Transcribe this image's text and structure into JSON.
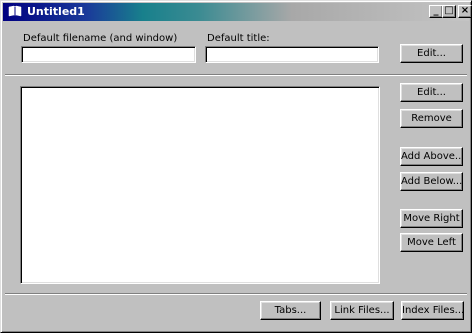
{
  "window": {
    "title": "Untitled1",
    "controls": {
      "minimize": "_",
      "maximize": "□",
      "close": "×"
    }
  },
  "form": {
    "default_filename_label": "Default filename (and window)",
    "default_filename_value": "",
    "default_title_label": "Default title:",
    "default_title_value": "",
    "edit_top_label": "Edit..."
  },
  "list": {
    "items": []
  },
  "side_buttons": {
    "edit": "Edit...",
    "remove": "Remove",
    "add_above": "Add Above...",
    "add_below": "Add Below...",
    "move_right": "Move Right",
    "move_left": "Move Left"
  },
  "bottom_buttons": {
    "tabs": "Tabs...",
    "link_files": "Link Files...",
    "index_files": "Index Files..."
  },
  "colors": {
    "face": "#c0c0c0",
    "title_start": "#000080",
    "title_mid": "#18808c"
  }
}
